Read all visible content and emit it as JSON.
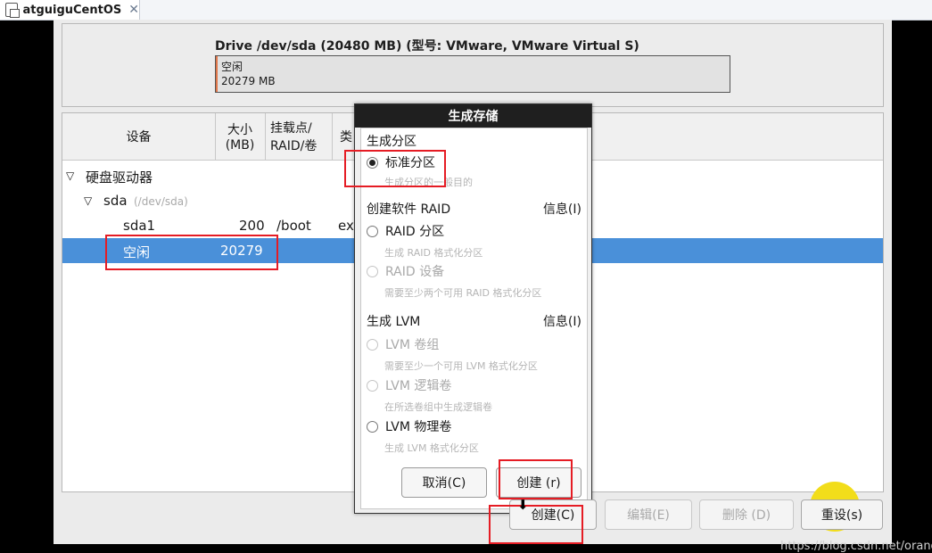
{
  "tab": {
    "title": "atguiguCentOS",
    "close": "✕"
  },
  "drive": {
    "title": "Drive /dev/sda (20480 MB) (型号: VMware, VMware Virtual S)",
    "free_label": "空闲",
    "free_size": "20279 MB"
  },
  "columns": {
    "device": "设备",
    "size_1": "大小",
    "size_2": "(MB)",
    "mount_1": "挂载点/",
    "mount_2": "RAID/卷",
    "type": "类"
  },
  "tree": {
    "root_label": "硬盘驱动器",
    "sda_label": "sda",
    "sda_path": "(/dev/sda)",
    "rows": [
      {
        "device": "sda1",
        "size": "200",
        "mount": "/boot",
        "type": "ex"
      },
      {
        "device": "空闲",
        "size": "20279",
        "mount": "",
        "type": ""
      }
    ]
  },
  "dialog": {
    "title": "生成存储",
    "section_partition": "生成分区",
    "opt_standard": "标准分区",
    "opt_standard_desc": "生成分区的一般目的",
    "section_raid": "创建软件 RAID",
    "info_raid": "信息(I)",
    "opt_raid_partition": "RAID 分区",
    "opt_raid_partition_desc": "生成 RAID 格式化分区",
    "opt_raid_device": "RAID 设备",
    "opt_raid_device_desc": "需要至少两个可用 RAID 格式化分区",
    "section_lvm": "生成 LVM",
    "info_lvm": "信息(I)",
    "opt_lvm_group": "LVM 卷组",
    "opt_lvm_group_desc": "需要至少一个可用 LVM 格式化分区",
    "opt_lvm_logical": "LVM 逻辑卷",
    "opt_lvm_logical_desc": "在所选卷组中生成逻辑卷",
    "opt_lvm_physical": "LVM 物理卷",
    "opt_lvm_physical_desc": "生成 LVM 格式化分区",
    "cancel": "取消(C)",
    "create": "创建 (r)"
  },
  "bottom": {
    "create": "创建(C)",
    "edit": "编辑(E)",
    "delete": "删除 (D)",
    "reset": "重设(s)"
  },
  "watermark": "https://blog.csdn.net/orangerfun",
  "colors": {
    "selection": "#4a90d9",
    "highlight": "#e51c24",
    "cursor": "#f2dd1a"
  }
}
